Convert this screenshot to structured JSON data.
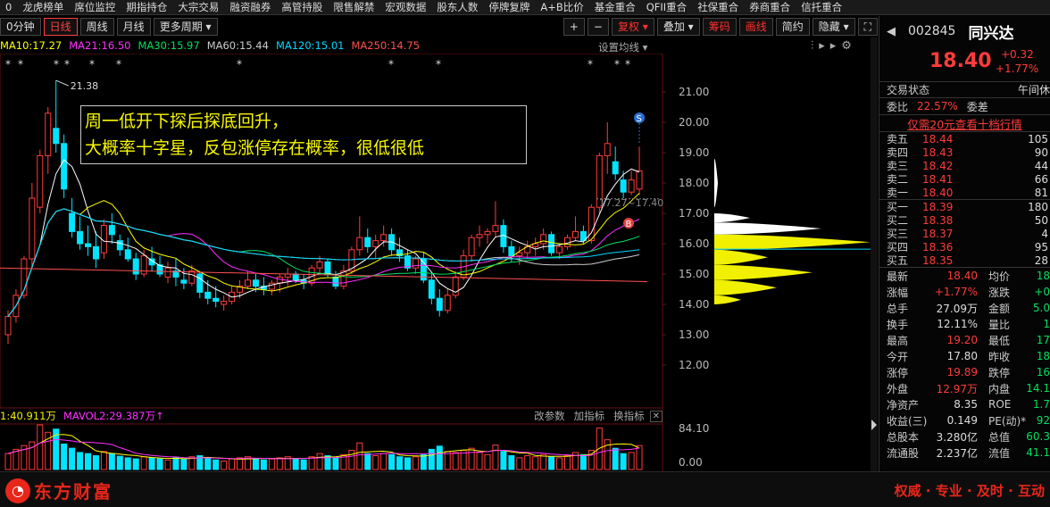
{
  "topnav": {
    "items": [
      "0",
      "龙虎榜单",
      "席位监控",
      "期指持仓",
      "大宗交易",
      "融资融券",
      "高管持股",
      "限售解禁",
      "宏观数据",
      "股东人数",
      "停牌复牌",
      "A+B比价",
      "基金重合",
      "QFII重合",
      "社保重合",
      "券商重合",
      "信托重合"
    ]
  },
  "toolbar": {
    "periods": [
      "0分钟",
      "日线",
      "周线",
      "月线",
      "更多周期"
    ],
    "right": [
      "+",
      "−",
      "复权",
      "叠加",
      "筹码",
      "画线",
      "简约",
      "隐藏"
    ]
  },
  "ma": [
    {
      "label": "MA10:17.27",
      "color": "#ffff00"
    },
    {
      "label": "MA21:16.50",
      "color": "#ff30ff"
    },
    {
      "label": "MA30:15.97",
      "color": "#00e060"
    },
    {
      "label": "MA60:15.44",
      "color": "#cccccc"
    },
    {
      "label": "MA120:15.01",
      "color": "#00d8ff"
    },
    {
      "label": "MA250:14.75",
      "color": "#ff5050"
    }
  ],
  "settings_label": "设置均线",
  "annotation": {
    "line1": "周一低开下探后探底回升，",
    "line2": "大概率十字星，反包涨停存在概率，很低很低"
  },
  "chart_data": {
    "type": "candlestick",
    "price_ticks": [
      "21.00",
      "20.00",
      "19.00",
      "18.00",
      "17.00",
      "16.00",
      "15.00",
      "14.00",
      "13.00",
      "12.00"
    ],
    "high_label": "21.38",
    "cost_label": "17.27~17.40",
    "candles": [
      [
        13.0,
        13.8,
        12.7,
        13.6
      ],
      [
        13.6,
        14.5,
        13.4,
        14.3
      ],
      [
        14.3,
        15.6,
        14.2,
        15.5
      ],
      [
        15.5,
        18.0,
        15.2,
        17.5
      ],
      [
        17.2,
        19.1,
        17.0,
        18.9
      ],
      [
        18.9,
        20.5,
        18.3,
        20.3
      ],
      [
        19.8,
        21.38,
        19.0,
        19.3
      ],
      [
        19.3,
        19.6,
        17.5,
        17.8
      ],
      [
        17.0,
        17.5,
        16.2,
        16.4
      ],
      [
        16.4,
        16.9,
        15.8,
        16.0
      ],
      [
        16.0,
        16.6,
        15.6,
        15.9
      ],
      [
        15.9,
        16.4,
        15.2,
        15.5
      ],
      [
        15.7,
        16.8,
        15.5,
        16.6
      ],
      [
        16.6,
        17.0,
        16.0,
        16.3
      ],
      [
        16.1,
        16.3,
        15.6,
        15.8
      ],
      [
        15.8,
        16.2,
        15.4,
        15.5
      ],
      [
        15.5,
        15.7,
        14.8,
        15.0
      ],
      [
        15.0,
        15.8,
        14.9,
        15.6
      ],
      [
        15.5,
        15.9,
        15.1,
        15.3
      ],
      [
        15.3,
        15.6,
        14.9,
        15.0
      ],
      [
        14.9,
        15.4,
        14.7,
        15.2
      ],
      [
        15.1,
        15.5,
        14.6,
        14.9
      ],
      [
        14.8,
        15.2,
        14.5,
        14.7
      ],
      [
        14.7,
        15.3,
        14.6,
        15.1
      ],
      [
        15.0,
        15.1,
        14.2,
        14.4
      ],
      [
        14.4,
        14.8,
        14.0,
        14.2
      ],
      [
        14.2,
        14.6,
        13.9,
        14.1
      ],
      [
        14.0,
        14.3,
        13.8,
        14.1
      ],
      [
        14.1,
        14.6,
        14.0,
        14.4
      ],
      [
        14.4,
        14.8,
        14.2,
        14.6
      ],
      [
        14.6,
        15.1,
        14.5,
        14.8
      ],
      [
        14.8,
        15.0,
        14.4,
        14.6
      ],
      [
        14.6,
        14.9,
        14.3,
        14.5
      ],
      [
        14.5,
        14.8,
        14.3,
        14.7
      ],
      [
        14.7,
        15.0,
        14.4,
        14.9
      ],
      [
        14.9,
        15.2,
        14.6,
        15.0
      ],
      [
        15.0,
        15.1,
        14.7,
        14.8
      ],
      [
        14.8,
        15.0,
        14.5,
        14.7
      ],
      [
        14.7,
        15.3,
        14.6,
        15.2
      ],
      [
        15.2,
        15.6,
        15.0,
        15.4
      ],
      [
        15.4,
        15.5,
        14.9,
        15.0
      ],
      [
        14.9,
        15.1,
        14.5,
        14.6
      ],
      [
        14.6,
        15.3,
        14.5,
        15.1
      ],
      [
        15.1,
        15.9,
        15.0,
        15.8
      ],
      [
        15.8,
        16.9,
        15.6,
        16.2
      ],
      [
        16.2,
        16.5,
        15.7,
        15.9
      ],
      [
        15.9,
        16.3,
        15.5,
        16.1
      ],
      [
        16.1,
        16.6,
        15.9,
        16.3
      ],
      [
        16.3,
        16.5,
        15.6,
        15.8
      ],
      [
        15.8,
        16.2,
        15.4,
        15.6
      ],
      [
        15.6,
        15.8,
        15.1,
        15.2
      ],
      [
        15.2,
        15.6,
        15.0,
        15.5
      ],
      [
        15.5,
        15.7,
        14.7,
        14.8
      ],
      [
        14.8,
        15.0,
        14.0,
        14.2
      ],
      [
        14.2,
        14.5,
        13.6,
        13.8
      ],
      [
        13.8,
        14.5,
        13.7,
        14.3
      ],
      [
        14.3,
        15.1,
        14.2,
        14.9
      ],
      [
        14.9,
        15.8,
        14.8,
        15.6
      ],
      [
        15.6,
        16.3,
        15.4,
        16.2
      ],
      [
        16.2,
        16.6,
        15.9,
        16.3
      ],
      [
        16.3,
        16.5,
        16.0,
        16.4
      ],
      [
        16.4,
        17.4,
        16.2,
        16.6
      ],
      [
        16.6,
        16.8,
        15.7,
        15.9
      ],
      [
        15.9,
        16.1,
        15.4,
        15.6
      ],
      [
        15.6,
        15.9,
        15.3,
        15.7
      ],
      [
        15.7,
        16.1,
        15.5,
        15.9
      ],
      [
        15.9,
        16.2,
        15.6,
        16.0
      ],
      [
        16.0,
        16.5,
        15.8,
        16.3
      ],
      [
        16.3,
        16.4,
        15.6,
        15.7
      ],
      [
        15.7,
        16.0,
        15.5,
        15.9
      ],
      [
        15.9,
        16.3,
        15.8,
        16.2
      ],
      [
        16.2,
        16.9,
        16.1,
        16.4
      ],
      [
        16.4,
        16.6,
        16.0,
        16.1
      ],
      [
        16.1,
        17.3,
        16.0,
        17.2
      ],
      [
        17.2,
        19.0,
        17.0,
        18.9
      ],
      [
        18.9,
        20.0,
        18.3,
        19.3
      ],
      [
        18.7,
        19.2,
        18.1,
        18.3
      ],
      [
        18.1,
        18.4,
        17.5,
        17.7
      ],
      [
        17.7,
        18.4,
        17.6,
        18.1
      ],
      [
        17.8,
        19.2,
        17.6,
        18.4
      ]
    ],
    "volume_ticks": [
      "84.10",
      "0.00"
    ],
    "volumes": [
      30,
      38,
      45,
      52,
      84,
      70,
      76,
      48,
      40,
      32,
      30,
      26,
      34,
      30,
      25,
      22,
      20,
      24,
      22,
      20,
      18,
      22,
      20,
      24,
      26,
      22,
      18,
      16,
      20,
      22,
      24,
      20,
      18,
      20,
      22,
      24,
      20,
      18,
      24,
      30,
      26,
      22,
      28,
      36,
      50,
      30,
      26,
      30,
      28,
      24,
      22,
      24,
      28,
      38,
      44,
      34,
      32,
      36,
      40,
      32,
      28,
      46,
      34,
      26,
      22,
      26,
      24,
      28,
      24,
      22,
      26,
      32,
      28,
      36,
      78,
      56,
      40,
      30,
      32,
      45
    ],
    "volume_colors": "red-up-cyan-down"
  },
  "vol_header": {
    "left": "1:40.911万",
    "mavol2": "MAVOL2:29.387万",
    "tools": [
      "改参数",
      "加指标",
      "换指标"
    ]
  },
  "quote": {
    "code": "002845",
    "name": "同兴达",
    "price": "18.40",
    "change": "+0.32",
    "change_pct": "+1.77%",
    "status_label": "交易状态",
    "status_value": "午间休",
    "weibi_label": "委比",
    "weibi": "22.57%",
    "weicha_label": "委差",
    "promo": "仅需20元查看十档行情",
    "asks": [
      {
        "l": "卖五",
        "p": "18.44",
        "v": "105"
      },
      {
        "l": "卖四",
        "p": "18.43",
        "v": "90"
      },
      {
        "l": "卖三",
        "p": "18.42",
        "v": "44"
      },
      {
        "l": "卖二",
        "p": "18.41",
        "v": "66"
      },
      {
        "l": "卖一",
        "p": "18.40",
        "v": "81"
      }
    ],
    "bids": [
      {
        "l": "买一",
        "p": "18.39",
        "v": "180"
      },
      {
        "l": "买二",
        "p": "18.38",
        "v": "50"
      },
      {
        "l": "买三",
        "p": "18.37",
        "v": "4"
      },
      {
        "l": "买四",
        "p": "18.36",
        "v": "95"
      },
      {
        "l": "买五",
        "p": "18.35",
        "v": "28"
      }
    ],
    "stats": [
      {
        "l1": "最新",
        "v1": "18.40",
        "l2": "均价",
        "v2": "18"
      },
      {
        "l1": "涨幅",
        "v1": "+1.77%",
        "l2": "涨跌",
        "v2": "+0"
      },
      {
        "l1": "总手",
        "v1": "27.09万",
        "l2": "金额",
        "v2": "5.0"
      },
      {
        "l1": "换手",
        "v1": "12.11%",
        "l2": "量比",
        "v2": "1"
      },
      {
        "l1": "最高",
        "v1": "19.20",
        "l2": "最低",
        "v2": "17"
      },
      {
        "l1": "今开",
        "v1": "17.80",
        "l2": "昨收",
        "v2": "18"
      },
      {
        "l1": "涨停",
        "v1": "19.89",
        "l2": "跌停",
        "v2": "16"
      },
      {
        "l1": "外盘",
        "v1": "12.97万",
        "l2": "内盘",
        "v2": "14.1"
      },
      {
        "l1": "净资产",
        "v1": "8.35",
        "l2": "ROE",
        "v2": "1.7"
      },
      {
        "l1": "收益(三)",
        "v1": "0.149",
        "l2": "PE(动)*",
        "v2": "92"
      },
      {
        "l1": "总股本",
        "v1": "3.280亿",
        "l2": "总值",
        "v2": "60.3"
      },
      {
        "l1": "流通股",
        "v1": "2.237亿",
        "l2": "流值",
        "v2": "41.1"
      }
    ]
  },
  "footer": {
    "logo": "东方财富",
    "slogan": "权威 · 专业 · 及时 · 互动"
  }
}
